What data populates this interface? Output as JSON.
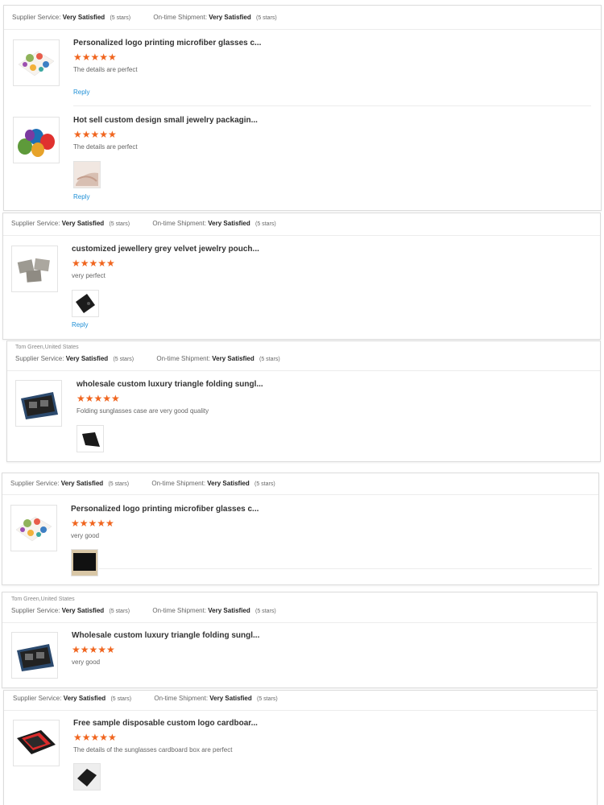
{
  "labels": {
    "supplier_service": "Supplier Service:",
    "ontime_shipment": "On-time Shipment:",
    "rating_value": "Very Satisfied",
    "rating_note": "(5 stars)",
    "reply": "Reply",
    "stars": "★★★★★"
  },
  "reviews": [
    {
      "title": "Personalized logo printing microfiber glasses c...",
      "comment": "The details are perfect"
    },
    {
      "title": "Hot sell custom design small jewelry packagin...",
      "comment": "The details are perfect"
    },
    {
      "title": "customized jewellery grey velvet jewelry pouch...",
      "comment": "very perfect"
    },
    {
      "reviewer": "Tom Green,United States",
      "title": "wholesale custom luxury triangle folding sungl...",
      "comment": "Folding sunglasses case are very good quality"
    },
    {
      "title": "Personalized logo printing microfiber glasses c...",
      "comment": "very good"
    },
    {
      "reviewer": "Tom Green,United States",
      "title": "Wholesale custom luxury triangle folding sungl...",
      "comment": "very good"
    },
    {
      "title": "Free sample disposable custom logo cardboar...",
      "comment": "The details of the sunglasses cardboard box are perfect"
    }
  ],
  "colors": {
    "star": "#f0651f",
    "link": "#1e8fd6"
  },
  "icons": {
    "star": "star-icon"
  }
}
